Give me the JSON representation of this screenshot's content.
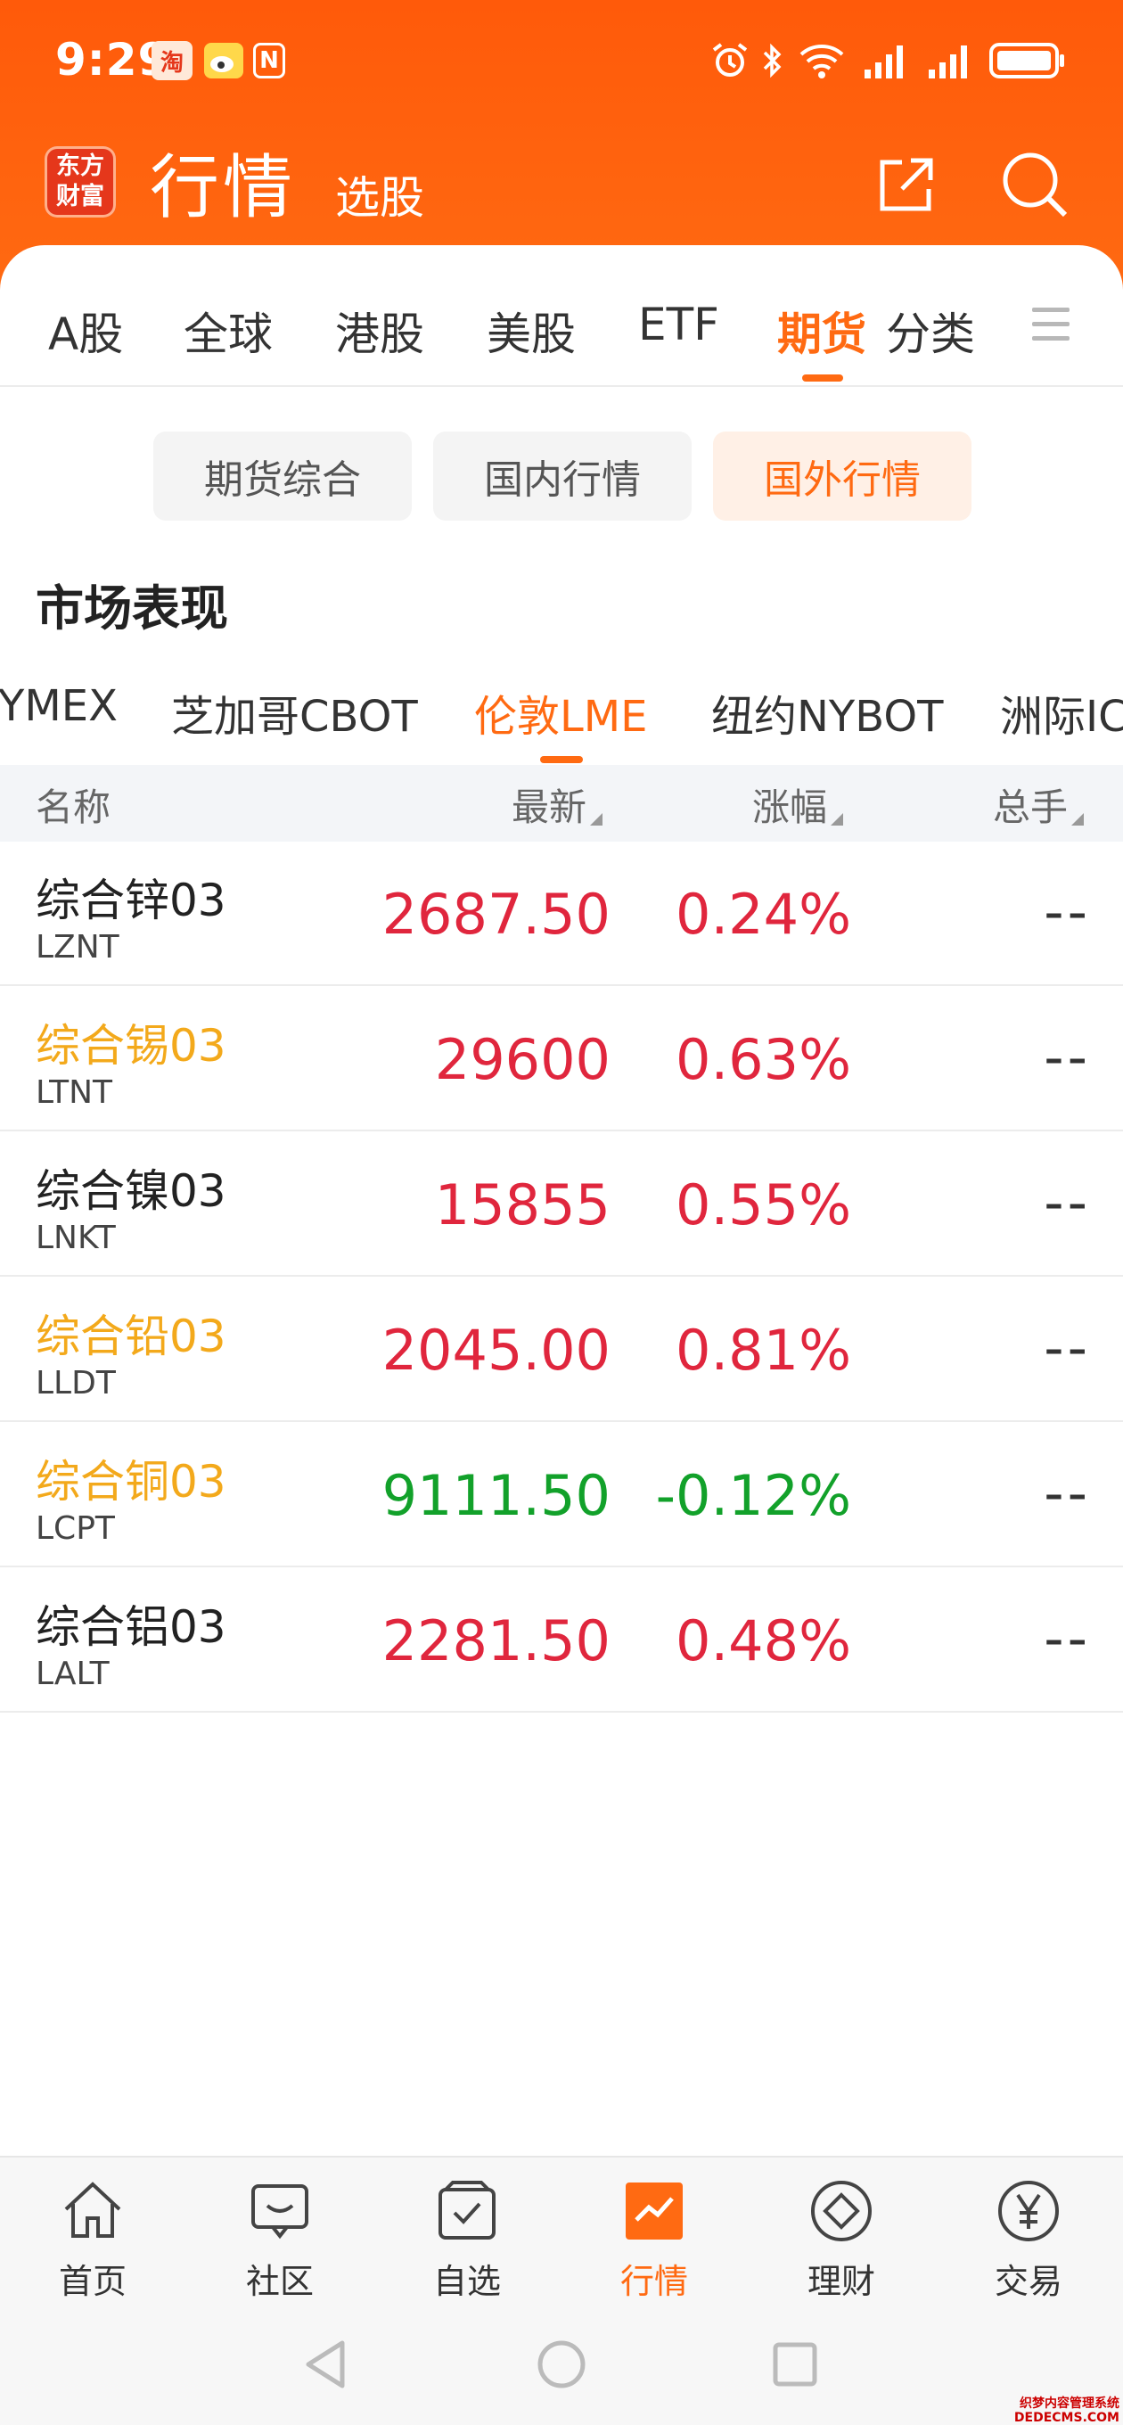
{
  "status_bar": {
    "time": "9:29",
    "taobao_badge": "淘",
    "nfc_badge": "N"
  },
  "header": {
    "logo_text": "东方财富",
    "title": "行情",
    "subtitle": "选股"
  },
  "category_tabs": [
    {
      "label": "A股",
      "active": false
    },
    {
      "label": "全球",
      "active": false
    },
    {
      "label": "港股",
      "active": false
    },
    {
      "label": "美股",
      "active": false
    },
    {
      "label": "ETF",
      "active": false
    },
    {
      "label": "期货",
      "active": true
    },
    {
      "label": "分类",
      "active": false
    }
  ],
  "sub_tabs": [
    {
      "label": "期货综合",
      "active": false
    },
    {
      "label": "国内行情",
      "active": false
    },
    {
      "label": "国外行情",
      "active": true
    }
  ],
  "section_title": "市场表现",
  "exchange_tabs": [
    {
      "label": "YMEX",
      "active": false
    },
    {
      "label": "芝加哥CBOT",
      "active": false
    },
    {
      "label": "伦敦LME",
      "active": true
    },
    {
      "label": "纽约NYBOT",
      "active": false
    },
    {
      "label": "洲际IC",
      "active": false
    }
  ],
  "table": {
    "columns": {
      "name": "名称",
      "latest": "最新",
      "change": "涨幅",
      "volume": "总手"
    },
    "rows": [
      {
        "name": "综合锌03",
        "code": "LZNT",
        "latest": "2687.50",
        "change": "0.24%",
        "volume": "--",
        "highlight": false,
        "direction": "up"
      },
      {
        "name": "综合锡03",
        "code": "LTNT",
        "latest": "29600",
        "change": "0.63%",
        "volume": "--",
        "highlight": true,
        "direction": "up"
      },
      {
        "name": "综合镍03",
        "code": "LNKT",
        "latest": "15855",
        "change": "0.55%",
        "volume": "--",
        "highlight": false,
        "direction": "up"
      },
      {
        "name": "综合铅03",
        "code": "LLDT",
        "latest": "2045.00",
        "change": "0.81%",
        "volume": "--",
        "highlight": true,
        "direction": "up"
      },
      {
        "name": "综合铜03",
        "code": "LCPT",
        "latest": "9111.50",
        "change": "-0.12%",
        "volume": "--",
        "highlight": true,
        "direction": "down"
      },
      {
        "name": "综合铝03",
        "code": "LALT",
        "latest": "2281.50",
        "change": "0.48%",
        "volume": "--",
        "highlight": false,
        "direction": "up"
      }
    ]
  },
  "bottom_nav": [
    {
      "label": "首页",
      "icon": "home-icon",
      "active": false
    },
    {
      "label": "社区",
      "icon": "chat-icon",
      "active": false
    },
    {
      "label": "自选",
      "icon": "checkbox-icon",
      "active": false
    },
    {
      "label": "行情",
      "icon": "trend-icon",
      "active": true
    },
    {
      "label": "理财",
      "icon": "diamond-icon",
      "active": false
    },
    {
      "label": "交易",
      "icon": "yen-icon",
      "active": false
    }
  ],
  "watermark": {
    "line1": "织梦内容管理系统",
    "line2": "DEDECMS.COM"
  },
  "colors": {
    "brand_orange": "#ff6a12",
    "up_red": "#e0263d",
    "down_green": "#12a12a",
    "highlight_gold": "#f3a91b"
  }
}
